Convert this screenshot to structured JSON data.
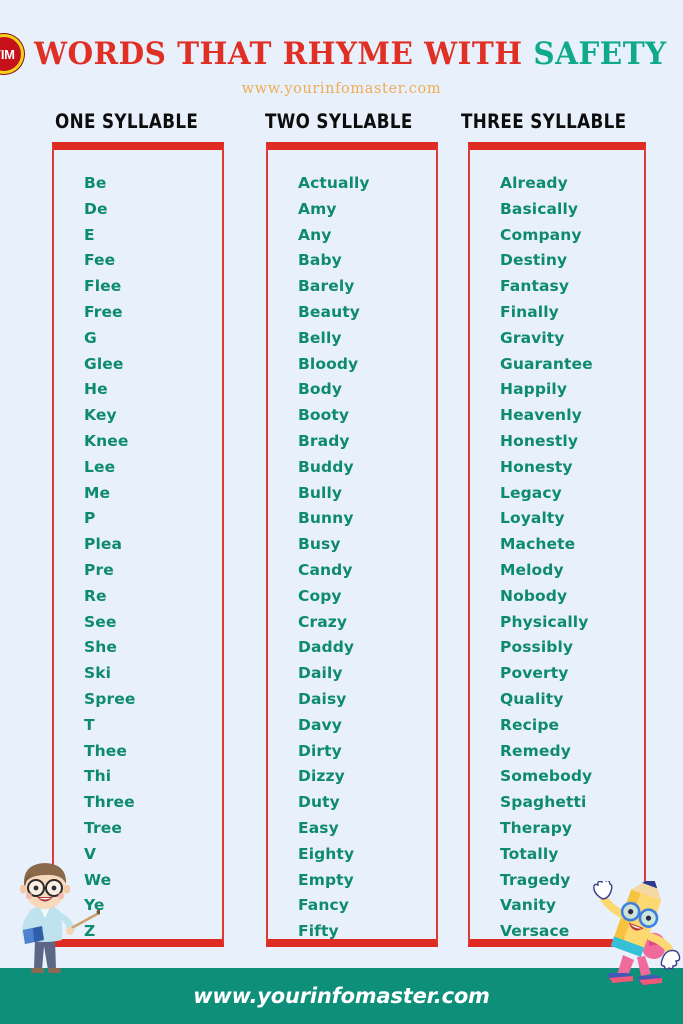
{
  "header": {
    "logo_text": "YIM",
    "logo_name": "yim-logo-icon",
    "title_part1": "WORDS THAT RHYME WITH ",
    "title_part2": "SAFETY",
    "title_full": "WORDS THAT RHYME WITH SAFETY",
    "subtitle": "www.yourinfomaster.com"
  },
  "colors": {
    "background": "#e8f1fb",
    "title_red": "#e03025",
    "title_teal": "#10a98c",
    "subtitle_orange": "#eeac53",
    "word_green": "#0e8a6e",
    "box_border_red": "#e02b22",
    "footer_teal": "#0d8f7a",
    "heading_black": "#0d0d0d"
  },
  "columns": [
    {
      "heading": "ONE SYLLABLE",
      "words": [
        "Be",
        "De",
        "E",
        "Fee",
        "Flee",
        "Free",
        "G",
        "Glee",
        "He",
        "Key",
        "Knee",
        "Lee",
        "Me",
        "P",
        "Plea",
        "Pre",
        "Re",
        "See",
        "She",
        "Ski",
        "Spree",
        "T",
        "Thee",
        "Thi",
        "Three",
        "Tree",
        "V",
        "We",
        "Ye",
        "Z"
      ]
    },
    {
      "heading": "TWO SYLLABLE",
      "words": [
        "Actually",
        "Amy",
        "Any",
        "Baby",
        "Barely",
        "Beauty",
        "Belly",
        "Bloody",
        "Body",
        "Booty",
        "Brady",
        "Buddy",
        "Bully",
        "Bunny",
        "Busy",
        "Candy",
        "Copy",
        "Crazy",
        "Daddy",
        "Daily",
        "Daisy",
        "Davy",
        "Dirty",
        "Dizzy",
        "Duty",
        "Easy",
        "Eighty",
        "Empty",
        "Fancy",
        "Fifty"
      ]
    },
    {
      "heading": "THREE SYLLABLE",
      "words": [
        "Already",
        "Basically",
        "Company",
        "Destiny",
        "Fantasy",
        "Finally",
        "Gravity",
        "Guarantee",
        "Happily",
        "Heavenly",
        "Honestly",
        "Honesty",
        "Legacy",
        "Loyalty",
        "Machete",
        "Melody",
        "Nobody",
        "Physically",
        "Possibly",
        "Poverty",
        "Quality",
        "Recipe",
        "Remedy",
        "Somebody",
        "Spaghetti",
        "Therapy",
        "Totally",
        "Tragedy",
        "Vanity",
        "Versace"
      ]
    }
  ],
  "footer": {
    "url": "www.yourinfomaster.com"
  },
  "mascots": {
    "left": "teacher-with-pointer-illustration",
    "right": "pencil-character-illustration"
  }
}
